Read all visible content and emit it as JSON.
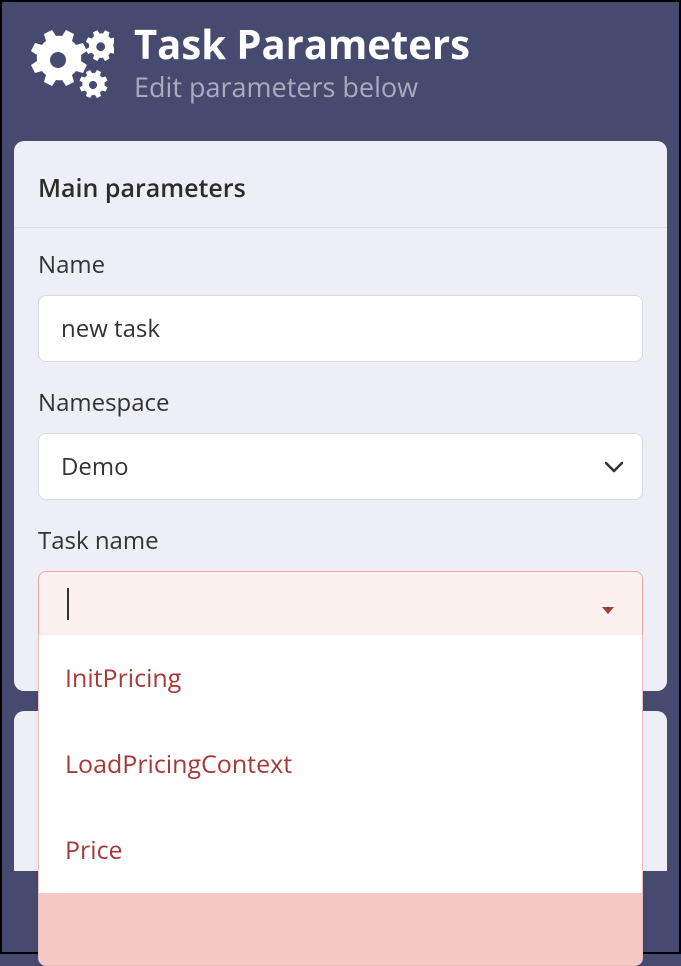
{
  "header": {
    "title": "Task Parameters",
    "subtitle": "Edit parameters below"
  },
  "card": {
    "heading": "Main parameters",
    "fields": {
      "name": {
        "label": "Name",
        "value": "new task"
      },
      "namespace": {
        "label": "Namespace",
        "value": "Demo"
      },
      "task_name": {
        "label": "Task name",
        "value": "",
        "options": [
          "InitPricing",
          "LoadPricingContext",
          "Price"
        ]
      }
    }
  },
  "colors": {
    "background": "#474a6f",
    "card_bg": "#eeeef6",
    "error_bg": "#fdf1ef",
    "error_border": "#e7a9a0",
    "option_text": "#a43a3a"
  }
}
